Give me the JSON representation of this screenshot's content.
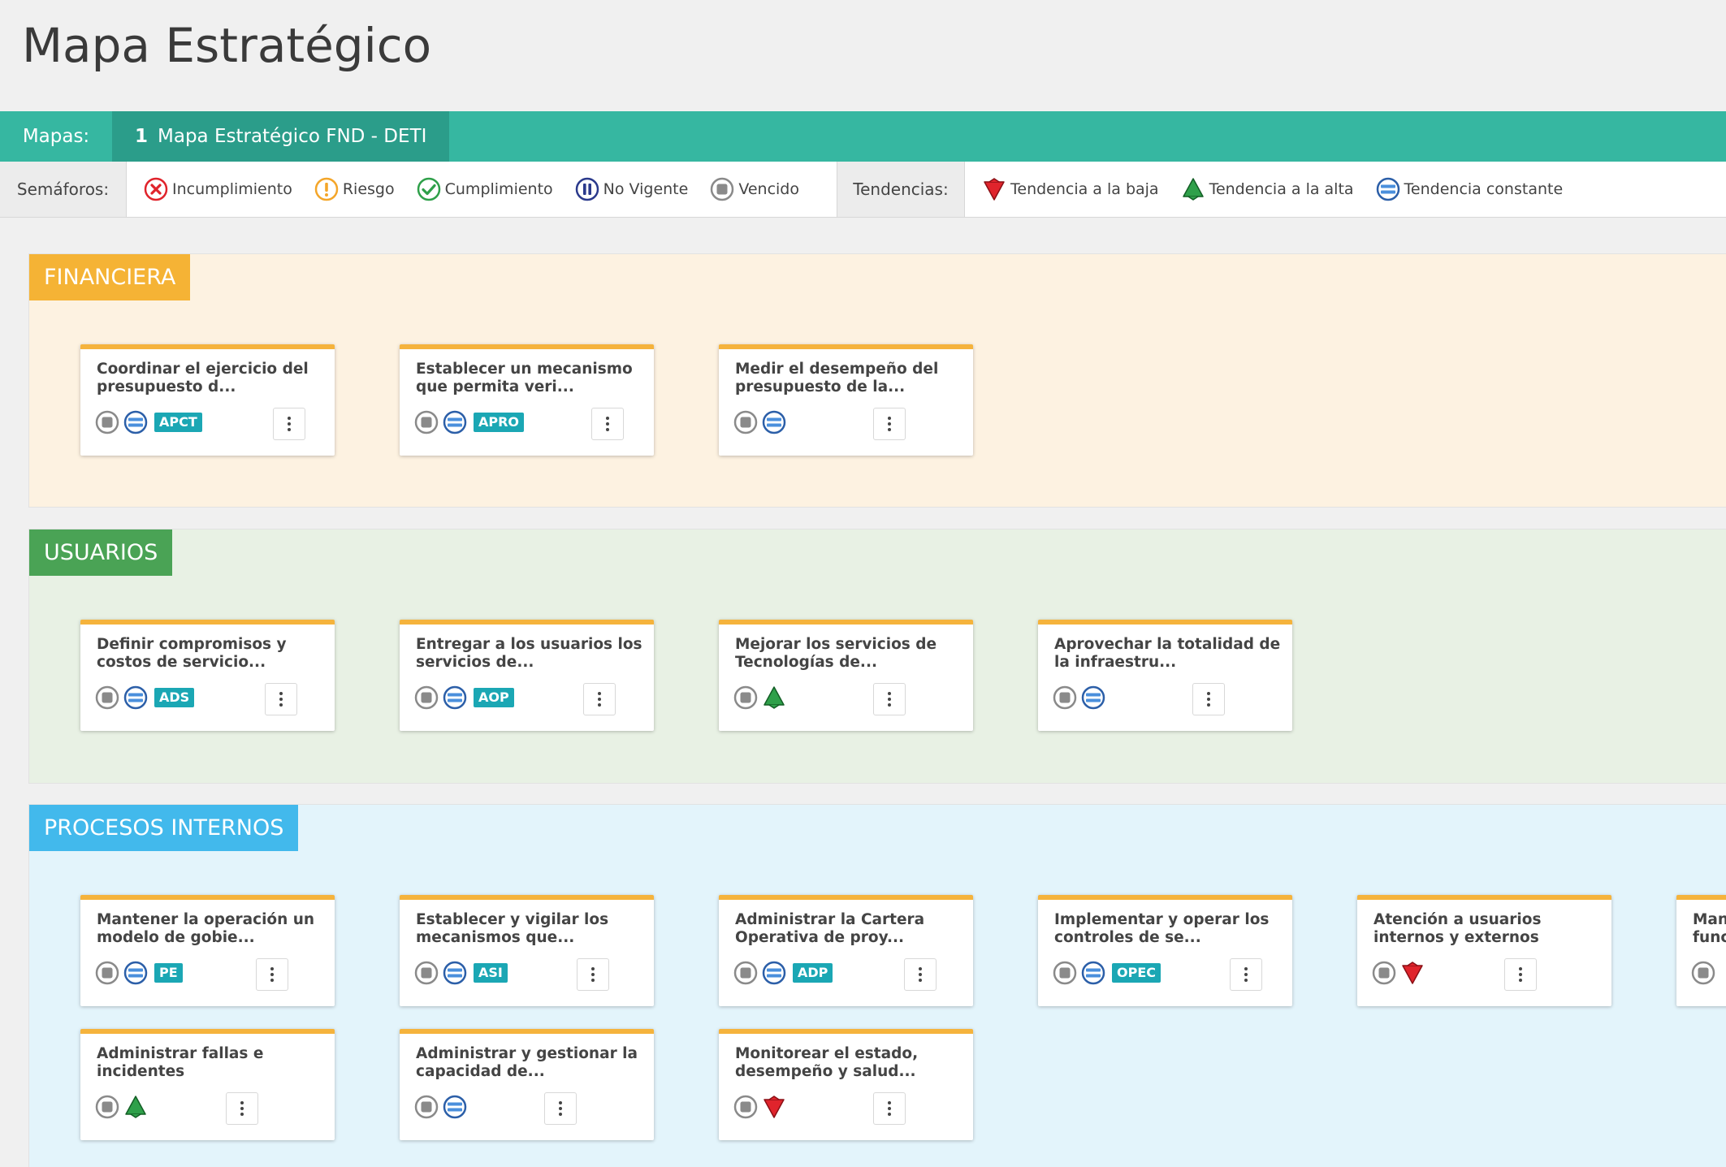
{
  "page_title": "Mapa Estratégico",
  "maps": {
    "label": "Mapas:",
    "tabs": [
      {
        "number": "1",
        "label": "Mapa Estratégico FND - DETI"
      }
    ]
  },
  "legend": {
    "semaforos_label": "Semáforos:",
    "semaforos": [
      {
        "label": "Incumplimiento",
        "icon": "incumplimiento-icon",
        "color": "#e0242c"
      },
      {
        "label": "Riesgo",
        "icon": "riesgo-icon",
        "color": "#f4a62a"
      },
      {
        "label": "Cumplimiento",
        "icon": "cumplimiento-icon",
        "color": "#2fa04a"
      },
      {
        "label": "No Vigente",
        "icon": "no-vigente-icon",
        "color": "#2b3a8c"
      },
      {
        "label": "Vencido",
        "icon": "vencido-icon",
        "color": "#8a8a8a"
      }
    ],
    "tendencias_label": "Tendencias:",
    "tendencias": [
      {
        "label": "Tendencia a la baja",
        "icon": "trend-down-icon",
        "color": "#e0242c"
      },
      {
        "label": "Tendencia a la alta",
        "icon": "trend-up-icon",
        "color": "#2fa04a"
      },
      {
        "label": "Tendencia constante",
        "icon": "trend-constant-icon",
        "color": "#2f6fc0"
      }
    ]
  },
  "sections": {
    "financiera": {
      "title": "FINANCIERA",
      "cards": [
        {
          "title": "Coordinar el ejercicio del presupuesto d...",
          "trend": "constant",
          "badge": "APCT"
        },
        {
          "title": "Establecer un mecanismo que permita veri...",
          "trend": "constant",
          "badge": "APRO"
        },
        {
          "title": "Medir el desempeño del presupuesto de la...",
          "trend": "constant",
          "badge": ""
        }
      ]
    },
    "usuarios": {
      "title": "USUARIOS",
      "cards": [
        {
          "title": "Definir compromisos y costos de servicio...",
          "trend": "constant",
          "badge": "ADS"
        },
        {
          "title": "Entregar a los usuarios los servicios de...",
          "trend": "constant",
          "badge": "AOP"
        },
        {
          "title": "Mejorar los servicios de Tecnologías de...",
          "trend": "up",
          "badge": ""
        },
        {
          "title": "Aprovechar la totalidad de la infraestru...",
          "trend": "constant",
          "badge": ""
        }
      ]
    },
    "procesos": {
      "title": "PROCESOS INTERNOS",
      "cards": [
        {
          "title": "Mantener la operación un modelo de gobie...",
          "trend": "constant",
          "badge": "PE"
        },
        {
          "title": "Establecer y vigilar los mecanismos que...",
          "trend": "constant",
          "badge": "ASI"
        },
        {
          "title": "Administrar la Cartera Operativa de proy...",
          "trend": "constant",
          "badge": "ADP"
        },
        {
          "title": "Implementar y operar los controles de se...",
          "trend": "constant",
          "badge": "OPEC"
        },
        {
          "title": "Atención a usuarios internos y externos",
          "trend": "down",
          "badge": ""
        },
        {
          "title": "Mant funci",
          "trend": "",
          "badge": ""
        },
        {
          "title": "Administrar fallas e incidentes",
          "trend": "up",
          "badge": ""
        },
        {
          "title": "Administrar y gestionar la capacidad de...",
          "trend": "constant",
          "badge": ""
        },
        {
          "title": "Monitorear el estado, desempeño y salud...",
          "trend": "down",
          "badge": ""
        }
      ]
    }
  },
  "colors": {
    "teal_bar": "#36b7a1",
    "teal_active_tab": "#2b9d8a",
    "financiera": "#f5b335",
    "usuarios": "#4aa355",
    "procesos": "#42b9ec",
    "badge": "#1ba7b4",
    "card_top_border": "#f5b33c"
  }
}
